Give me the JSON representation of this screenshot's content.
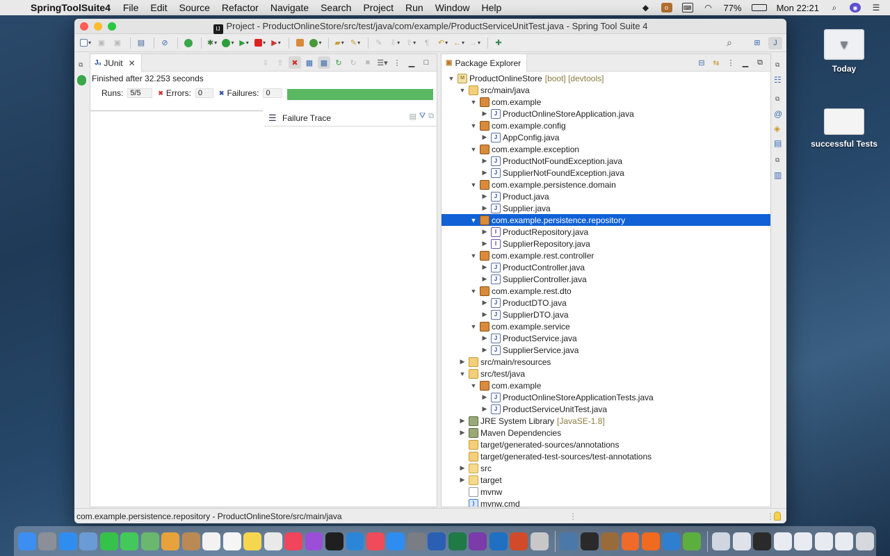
{
  "menubar": {
    "app_name": "SpringToolSuite4",
    "items": [
      "File",
      "Edit",
      "Source",
      "Refactor",
      "Navigate",
      "Search",
      "Project",
      "Run",
      "Window",
      "Help"
    ],
    "battery": "77%",
    "clock": "Mon 22:21"
  },
  "desktop": {
    "items": [
      {
        "label": "Today",
        "icon": "folder-download-icon"
      },
      {
        "label": "successful Tests",
        "icon": "screenshot-thumbnail"
      }
    ]
  },
  "window": {
    "title": "Project - ProductOnlineStore/src/test/java/com/example/ProductServiceUnitTest.java - Spring Tool Suite 4"
  },
  "junit": {
    "tab_label": "JUnit",
    "finished_text": "Finished after 32.253 seconds",
    "runs_label": "Runs:",
    "runs_value": "5/5",
    "errors_label": "Errors:",
    "errors_value": "0",
    "failures_label": "Failures:",
    "failures_value": "0",
    "progress": 1.0,
    "progress_color": "#5ab863",
    "failure_trace_label": "Failure Trace"
  },
  "package_explorer": {
    "tab_label": "Package Explorer",
    "tree": [
      {
        "depth": 0,
        "tw": "open",
        "icon": "project",
        "label": "ProductOnlineStore",
        "deco": "[boot] [devtools]"
      },
      {
        "depth": 1,
        "tw": "open",
        "icon": "srcfolder",
        "label": "src/main/java"
      },
      {
        "depth": 2,
        "tw": "open",
        "icon": "package",
        "label": "com.example"
      },
      {
        "depth": 3,
        "tw": "closed",
        "icon": "java",
        "label": "ProductOnlineStoreApplication.java"
      },
      {
        "depth": 2,
        "tw": "open",
        "icon": "package",
        "label": "com.example.config"
      },
      {
        "depth": 3,
        "tw": "closed",
        "icon": "java",
        "label": "AppConfig.java"
      },
      {
        "depth": 2,
        "tw": "open",
        "icon": "package",
        "label": "com.example.exception"
      },
      {
        "depth": 3,
        "tw": "closed",
        "icon": "java",
        "label": "ProductNotFoundException.java"
      },
      {
        "depth": 3,
        "tw": "closed",
        "icon": "java",
        "label": "SupplierNotFoundException.java"
      },
      {
        "depth": 2,
        "tw": "open",
        "icon": "package",
        "label": "com.example.persistence.domain"
      },
      {
        "depth": 3,
        "tw": "closed",
        "icon": "java",
        "label": "Product.java"
      },
      {
        "depth": 3,
        "tw": "closed",
        "icon": "java",
        "label": "Supplier.java"
      },
      {
        "depth": 2,
        "tw": "open",
        "icon": "package",
        "label": "com.example.persistence.repository",
        "selected": true
      },
      {
        "depth": 3,
        "tw": "closed",
        "icon": "iface",
        "label": "ProductRepository.java"
      },
      {
        "depth": 3,
        "tw": "closed",
        "icon": "iface",
        "label": "SupplierRepository.java"
      },
      {
        "depth": 2,
        "tw": "open",
        "icon": "package",
        "label": "com.example.rest.controller"
      },
      {
        "depth": 3,
        "tw": "closed",
        "icon": "java",
        "label": "ProductController.java"
      },
      {
        "depth": 3,
        "tw": "closed",
        "icon": "java",
        "label": "SupplierController.java"
      },
      {
        "depth": 2,
        "tw": "open",
        "icon": "package",
        "label": "com.example.rest.dto"
      },
      {
        "depth": 3,
        "tw": "closed",
        "icon": "java",
        "label": "ProductDTO.java"
      },
      {
        "depth": 3,
        "tw": "closed",
        "icon": "java",
        "label": "SupplierDTO.java"
      },
      {
        "depth": 2,
        "tw": "open",
        "icon": "package",
        "label": "com.example.service"
      },
      {
        "depth": 3,
        "tw": "closed",
        "icon": "java",
        "label": "ProductService.java"
      },
      {
        "depth": 3,
        "tw": "closed",
        "icon": "java",
        "label": "SupplierService.java"
      },
      {
        "depth": 1,
        "tw": "closed",
        "icon": "srcfolder",
        "label": "src/main/resources"
      },
      {
        "depth": 1,
        "tw": "open",
        "icon": "srcfolder",
        "label": "src/test/java"
      },
      {
        "depth": 2,
        "tw": "open",
        "icon": "package",
        "label": "com.example"
      },
      {
        "depth": 3,
        "tw": "closed",
        "icon": "java",
        "label": "ProductOnlineStoreApplicationTests.java"
      },
      {
        "depth": 3,
        "tw": "closed",
        "icon": "java",
        "label": "ProductServiceUnitTest.java"
      },
      {
        "depth": 1,
        "tw": "closed",
        "icon": "lib",
        "label": "JRE System Library",
        "deco": "[JavaSE-1.8]"
      },
      {
        "depth": 1,
        "tw": "closed",
        "icon": "lib",
        "label": "Maven Dependencies"
      },
      {
        "depth": 1,
        "tw": "none",
        "icon": "srcfolder",
        "label": "target/generated-sources/annotations"
      },
      {
        "depth": 1,
        "tw": "none",
        "icon": "srcfolder",
        "label": "target/generated-test-sources/test-annotations"
      },
      {
        "depth": 1,
        "tw": "closed",
        "icon": "folder",
        "label": "src"
      },
      {
        "depth": 1,
        "tw": "closed",
        "icon": "folder",
        "label": "target"
      },
      {
        "depth": 1,
        "tw": "none",
        "icon": "file",
        "label": "mvnw"
      },
      {
        "depth": 1,
        "tw": "none",
        "icon": "cmd",
        "label": "mvnw.cmd"
      }
    ]
  },
  "statusbar": {
    "text": "com.example.persistence.repository - ProductOnlineStore/src/main/java"
  },
  "dock": {
    "apps": [
      {
        "name": "finder-icon",
        "color": "#3c8ff0"
      },
      {
        "name": "launchpad-icon",
        "color": "#8a8f99"
      },
      {
        "name": "safari-icon",
        "color": "#2f8df0"
      },
      {
        "name": "preview-icon",
        "color": "#6b9bd6"
      },
      {
        "name": "facetime-icon",
        "color": "#36c24a"
      },
      {
        "name": "messages-icon",
        "color": "#43c95a"
      },
      {
        "name": "maps-icon",
        "color": "#69b86e"
      },
      {
        "name": "photos-icon",
        "color": "#e7a23c"
      },
      {
        "name": "contacts-icon",
        "color": "#b98a55"
      },
      {
        "name": "calendar-icon",
        "color": "#f2f2f2"
      },
      {
        "name": "reminders-icon",
        "color": "#f5f5f5"
      },
      {
        "name": "notes-icon",
        "color": "#f6d64e"
      },
      {
        "name": "freeform-icon",
        "color": "#e9e9e9"
      },
      {
        "name": "music-icon",
        "color": "#f0455c"
      },
      {
        "name": "podcasts-icon",
        "color": "#9a4fd6"
      },
      {
        "name": "tv-icon",
        "color": "#1f1f1f"
      },
      {
        "name": "onedrive-icon",
        "color": "#2c86d8"
      },
      {
        "name": "news-icon",
        "color": "#f04b5a"
      },
      {
        "name": "appstore-icon",
        "color": "#2f8cf0"
      },
      {
        "name": "system-preferences-icon",
        "color": "#7a7d84"
      },
      {
        "name": "word-icon",
        "color": "#2b5fb4"
      },
      {
        "name": "excel-icon",
        "color": "#1f7a45"
      },
      {
        "name": "onenote-icon",
        "color": "#7b3ba8"
      },
      {
        "name": "outlook-icon",
        "color": "#1f6fc2"
      },
      {
        "name": "powerpoint-icon",
        "color": "#d14a29"
      },
      {
        "name": "help-icon",
        "color": "#c8c8c8"
      },
      {
        "name": "wireshark-icon",
        "color": "#4a78a8"
      },
      {
        "name": "terminal-icon",
        "color": "#2a2a2a"
      },
      {
        "name": "owl-icon",
        "color": "#9a6b3a"
      },
      {
        "name": "brave-icon",
        "color": "#f06a2a"
      },
      {
        "name": "pencil-icon",
        "color": "#f06a20"
      },
      {
        "name": "vscode-icon",
        "color": "#2f7fd0"
      },
      {
        "name": "spring-icon",
        "color": "#5caf3e"
      },
      {
        "name": "mail-window-icon",
        "color": "#cfd6e0"
      },
      {
        "name": "window-thumb-1",
        "color": "#dfe3e9"
      },
      {
        "name": "window-thumb-2",
        "color": "#2a2a2a"
      },
      {
        "name": "window-thumb-3",
        "color": "#e8ecf2"
      },
      {
        "name": "window-thumb-4",
        "color": "#e8ecf2"
      },
      {
        "name": "window-thumb-5",
        "color": "#e8ecf2"
      },
      {
        "name": "window-thumb-6",
        "color": "#e8ecf2"
      },
      {
        "name": "trash-icon",
        "color": "#d5d9de"
      }
    ]
  }
}
